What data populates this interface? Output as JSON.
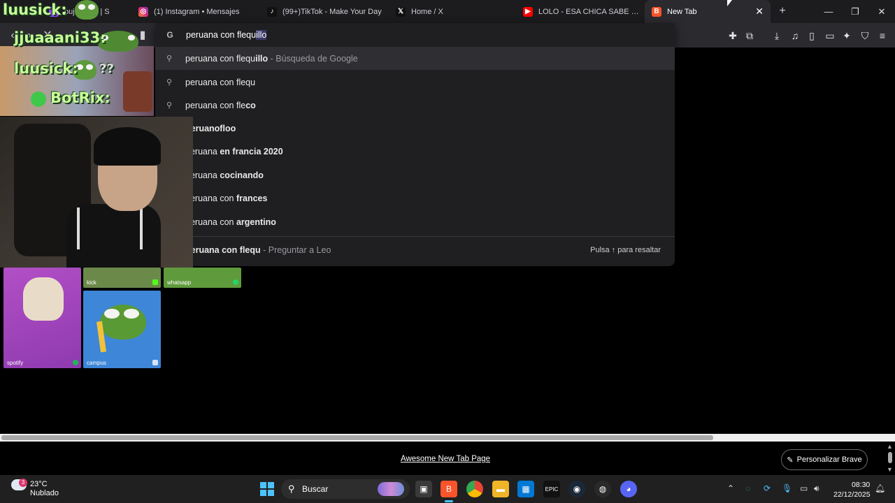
{
  "tabs": [
    {
      "title": "puj... rosb | S",
      "favicon": "twitch-icon",
      "color": "#9146ff"
    },
    {
      "title": "(1) Instagram • Mensajes",
      "favicon": "instagram-icon",
      "color": "#d62976"
    },
    {
      "title": "(99+)TikTok - Make Your Day",
      "favicon": "tiktok-icon",
      "color": "#111111"
    },
    {
      "title": "Home / X",
      "favicon": "x-icon",
      "color": "#111111"
    },
    {
      "title": "LOLO - ESA CHICA SABE ENROL",
      "favicon": "youtube-icon",
      "color": "#ff0000"
    },
    {
      "title": "New Tab",
      "favicon": "brave-icon",
      "color": "#fb542b"
    }
  ],
  "omnibox": {
    "typed": "peruana con flequ",
    "completion": "illo"
  },
  "suggestions": [
    {
      "normal": "peruana con flequ",
      "bold": "illo",
      "sub": " - Búsqueda de Google"
    },
    {
      "normal": "peruana con flequ",
      "bold": "",
      "sub": ""
    },
    {
      "normal": "peruana con fle",
      "bold": "co",
      "sub": ""
    },
    {
      "normal": "",
      "bold": "peruanofloo",
      "sub": ""
    },
    {
      "normal": "peruana ",
      "bold": "en francia 2020",
      "sub": ""
    },
    {
      "normal": "peruana ",
      "bold": "cocinando",
      "sub": ""
    },
    {
      "normal": "peruana con ",
      "bold": "frances",
      "sub": ""
    },
    {
      "normal": "peruana con ",
      "bold": "argentino",
      "sub": ""
    }
  ],
  "leo": {
    "query": "peruana con flequ",
    "action": " - Preguntar a Leo",
    "hint": "Pulsa ↑ para resaltar"
  },
  "overlay": {
    "chat_lines": [
      "luusick:",
      "jjuaaani33:",
      "luusick:",
      "BotRix:"
    ],
    "question_marks": "??"
  },
  "speed_dial": [
    {
      "label": "kick",
      "color": "#53fc18"
    },
    {
      "label": "whatsapp",
      "color": "#25d366"
    },
    {
      "label": "spotify",
      "color": "#1db954"
    },
    {
      "label": "campus",
      "color": "#3a8ad8"
    }
  ],
  "footer": {
    "link": "Awesome New Tab Page",
    "customize": "Personalizar Brave"
  },
  "taskbar": {
    "weather_temp": "23°C",
    "weather_desc": "Nublado",
    "weather_badge": "3",
    "search_label": "Buscar",
    "clock_time": "08:30",
    "clock_date": "22/12/2025"
  },
  "colors": {
    "accent_brave": "#fb542b",
    "chat_green": "#c8ff9a"
  }
}
